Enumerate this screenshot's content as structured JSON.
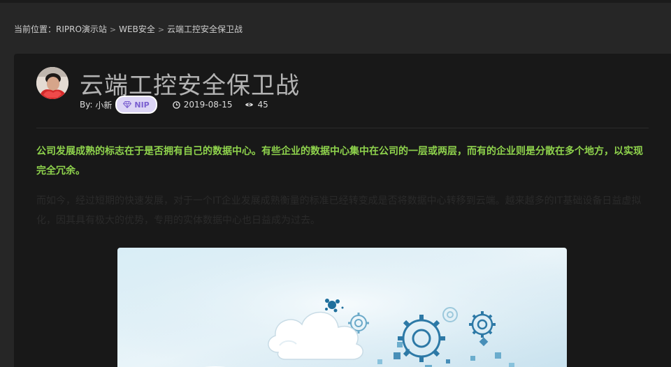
{
  "breadcrumb": {
    "prefix": "当前位置：",
    "items": [
      "RIPRO演示站",
      "WEB安全",
      "云端工控安全保卫战"
    ],
    "separator": ">"
  },
  "article": {
    "title": "云端工控安全保卫战",
    "author_prefix": "By: ",
    "author": "小新",
    "badge": "NIP",
    "date": "2019-08-15",
    "views": "45",
    "lead": "公司发展成熟的标志在于是否拥有自己的数据中心。有些企业的数据中心集中在公司的一层或两层，而有的企业则是分散在多个地方，以实现完全冗余。",
    "paragraph": "而如今，经过短期的快速发展，对于一个IT企业发展成熟衡量的标准已经转变成是否将数据中心转移到云端。越来越多的IT基础设备日益虚拟化，因其具有极大的优势，专用的实体数据中心也日益成为过去。"
  },
  "colors": {
    "background": "#262626",
    "card": "#181818",
    "title": "#b3b3b3",
    "lead": "#8ed24c",
    "badge_bg": "#dcd5f5",
    "badge_text": "#7a5fd0"
  },
  "icons": [
    "diamond-icon",
    "clock-icon",
    "eye-icon"
  ]
}
